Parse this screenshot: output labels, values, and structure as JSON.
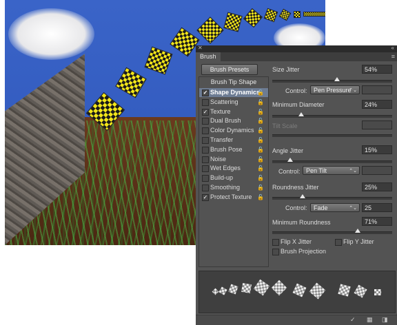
{
  "panel": {
    "tab": "Brush",
    "presets_button": "Brush Presets",
    "sidebar_header": "Brush Tip Shape",
    "items": [
      {
        "label": "Shape Dynamics",
        "checked": true,
        "active": true
      },
      {
        "label": "Scattering",
        "checked": false
      },
      {
        "label": "Texture",
        "checked": true
      },
      {
        "label": "Dual Brush",
        "checked": false
      },
      {
        "label": "Color Dynamics",
        "checked": false
      },
      {
        "label": "Transfer",
        "checked": false
      },
      {
        "label": "Brush Pose",
        "checked": false
      },
      {
        "label": "Noise",
        "checked": false
      },
      {
        "label": "Wet Edges",
        "checked": false
      },
      {
        "label": "Build-up",
        "checked": false
      },
      {
        "label": "Smoothing",
        "checked": false
      },
      {
        "label": "Protect Texture",
        "checked": true
      }
    ],
    "size_jitter": {
      "label": "Size Jitter",
      "value": "54%",
      "level": 0.54
    },
    "control1": {
      "label": "Control:",
      "value": "Pen Pressure"
    },
    "min_diameter": {
      "label": "Minimum Diameter",
      "value": "24%",
      "level": 0.24
    },
    "tilt_scale": {
      "label": "Tilt Scale",
      "value": ""
    },
    "angle_jitter": {
      "label": "Angle Jitter",
      "value": "15%",
      "level": 0.15
    },
    "control2": {
      "label": "Control:",
      "value": "Pen Tilt"
    },
    "roundness_jitter": {
      "label": "Roundness Jitter",
      "value": "25%",
      "level": 0.25
    },
    "control3": {
      "label": "Control:",
      "value": "Fade",
      "steps": "25"
    },
    "min_roundness": {
      "label": "Minimum Roundness",
      "value": "71%",
      "level": 0.71
    },
    "flip_x": "Flip X Jitter",
    "flip_y": "Flip Y Jitter",
    "brush_projection": "Brush Projection"
  },
  "icons": {
    "lock": "lock-icon",
    "close": "close-icon",
    "collapse": "collapse-icon",
    "menu": "panel-menu-icon",
    "dropdown": "chevron-down-icon"
  },
  "colors": {
    "panel_bg": "#535353",
    "active_item": "#6d7c93",
    "sky": "#3a64c8",
    "checker_yellow": "#f2e61a"
  }
}
